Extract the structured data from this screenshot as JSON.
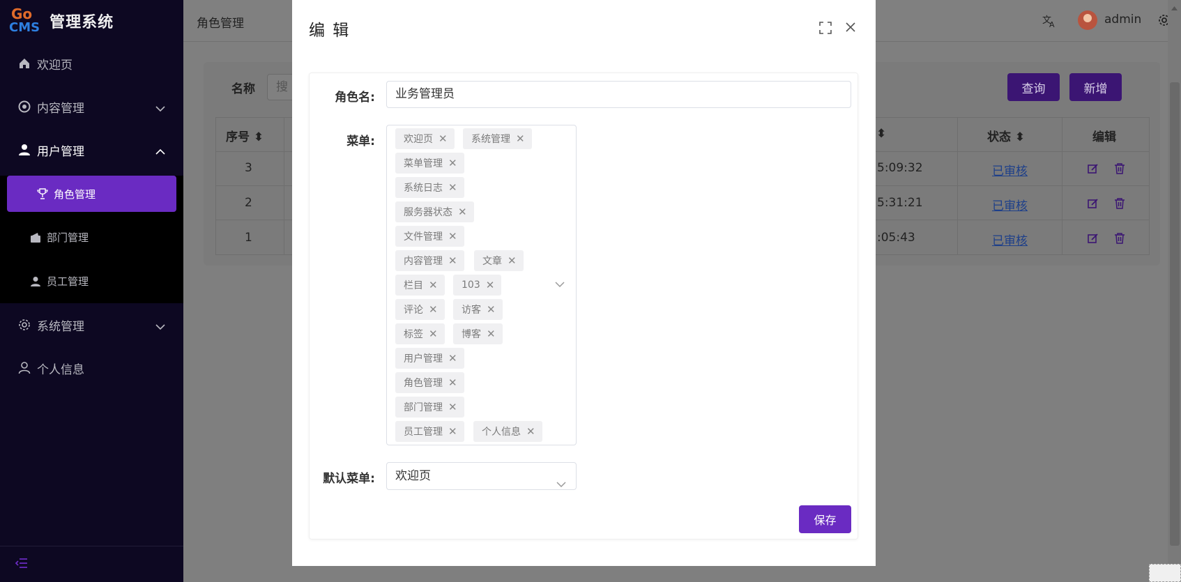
{
  "app": {
    "logo_top": "Go",
    "logo_bottom": "CMS",
    "title": "管理系统"
  },
  "sidebar": {
    "items": [
      {
        "label": "欢迎页",
        "icon": "home-icon"
      },
      {
        "label": "内容管理",
        "icon": "chrome-icon"
      },
      {
        "label": "用户管理",
        "icon": "user-icon"
      },
      {
        "label": "系统管理",
        "icon": "gear-icon"
      },
      {
        "label": "个人信息",
        "icon": "person-icon"
      }
    ],
    "sub_items": [
      {
        "label": "角色管理",
        "icon": "trophy-icon",
        "active": true
      },
      {
        "label": "部门管理",
        "icon": "wallet-icon"
      },
      {
        "label": "员工管理",
        "icon": "user-icon"
      }
    ]
  },
  "header": {
    "page_name": "角色管理",
    "username": "admin"
  },
  "background": {
    "filter_label": "名称",
    "filter_placeholder": "搜",
    "query_button": "查询",
    "add_button": "新增",
    "columns": {
      "index": "序号",
      "status": "状态",
      "edit": "编辑"
    },
    "rows": [
      {
        "index": "3",
        "time": "5:09:32",
        "status": "已审核"
      },
      {
        "index": "2",
        "time": "5:31:21",
        "status": "已审核"
      },
      {
        "index": "1",
        "time": ":05:43",
        "status": "已审核"
      }
    ]
  },
  "dialog": {
    "title": "编 辑",
    "role_name_label": "角色名:",
    "role_name_value": "业务管理员",
    "menu_label": "菜单:",
    "menu_tags": [
      "欢迎页",
      "系统管理",
      "菜单管理",
      "系统日志",
      "服务器状态",
      "文件管理",
      "内容管理",
      "文章",
      "栏目",
      "103",
      "评论",
      "访客",
      "标签",
      "博客",
      "用户管理",
      "角色管理",
      "部门管理",
      "员工管理",
      "个人信息"
    ],
    "default_menu_label": "默认菜单:",
    "default_menu_value": "欢迎页",
    "save_button": "保存"
  },
  "colors": {
    "accent": "#6a2bc2",
    "sidebar_bg": "#0d0822",
    "link": "#1d3f8a"
  }
}
